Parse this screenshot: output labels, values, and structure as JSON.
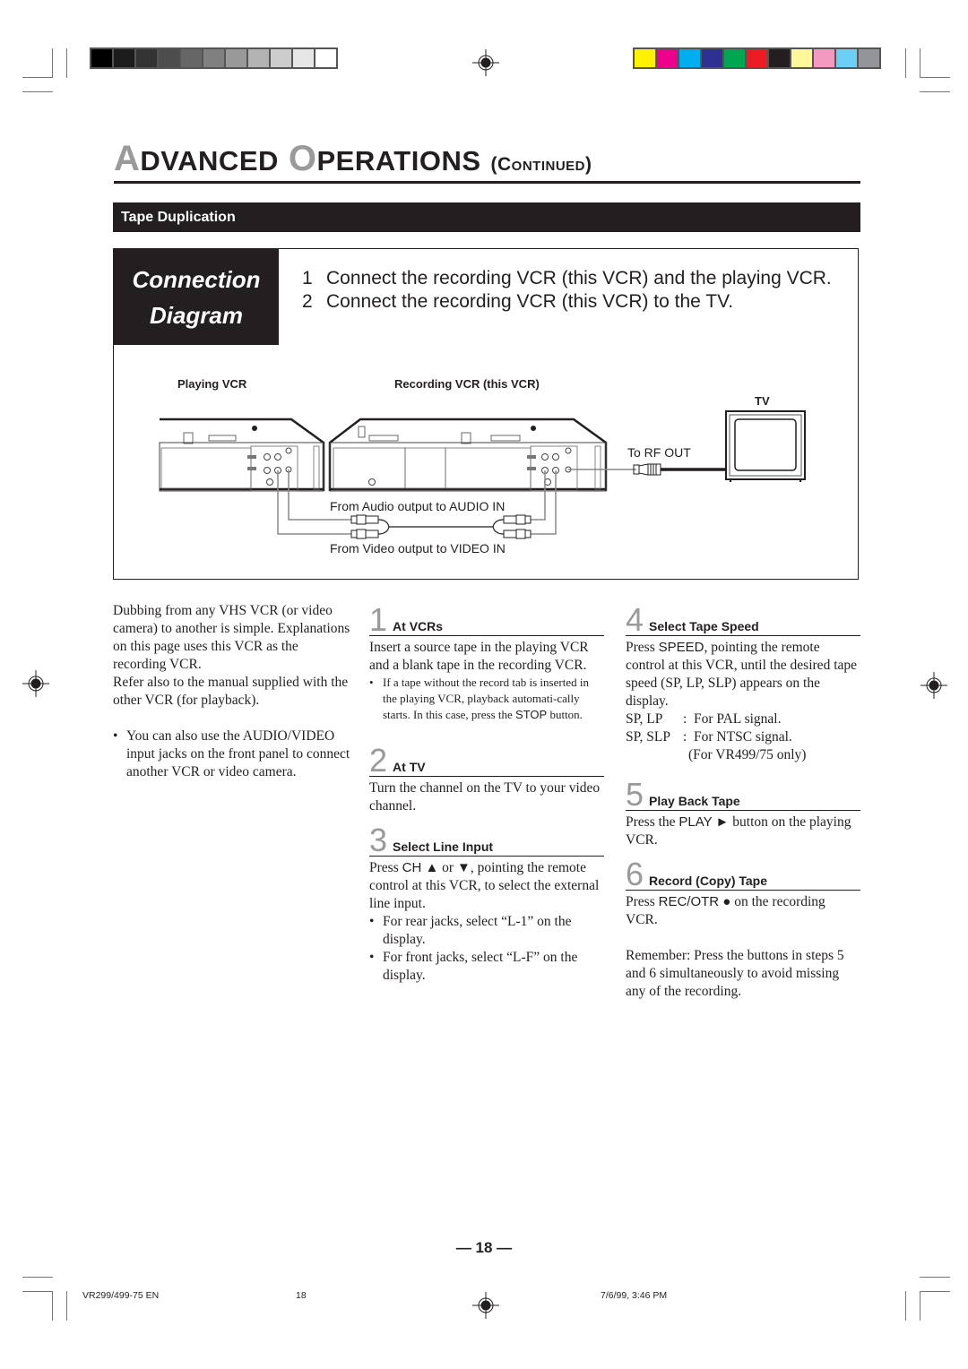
{
  "print_marks": {
    "grayscale_swatches": [
      "#000000",
      "#1c1c1c",
      "#333333",
      "#4d4d4d",
      "#666666",
      "#808080",
      "#999999",
      "#b3b3b3",
      "#cccccc",
      "#e6e6e6",
      "#ffffff"
    ],
    "color_swatches": [
      "#fff200",
      "#ec008c",
      "#00aeef",
      "#2e3192",
      "#00a651",
      "#ed1c24",
      "#231f20",
      "#fff799",
      "#f49ac1",
      "#6dcff6",
      "#939598"
    ]
  },
  "header": {
    "title_cap_a": "A",
    "title_rest_a": "DVANCED",
    "title_cap_o": "O",
    "title_rest_o": "PERATIONS",
    "title_paren_open": "(",
    "title_paren_cap": "C",
    "title_paren_rest": "ONTINUED",
    "title_paren_close": ")"
  },
  "section": {
    "title": "Tape Duplication"
  },
  "connection": {
    "label_line1": "Connection",
    "label_line2": "Diagram",
    "steps": [
      {
        "num": "1",
        "text": "Connect the recording VCR (this VCR) and the playing VCR."
      },
      {
        "num": "2",
        "text": "Connect the recording VCR (this VCR) to the TV."
      }
    ]
  },
  "diagram": {
    "playing_vcr_label": "Playing VCR",
    "recording_vcr_label": "Recording VCR (this VCR)",
    "tv_label": "TV",
    "rf_out_label": "To RF OUT",
    "audio_label": "From Audio output to AUDIO IN",
    "video_label": "From Video output to VIDEO IN"
  },
  "intro": {
    "paragraph": "Dubbing from any VHS VCR (or video camera) to another is simple. Explanations on this page uses this VCR as the recording VCR.",
    "paragraph2": "Refer also to the manual supplied with the other VCR (for playback).",
    "bullet": "You can also use the AUDIO/VIDEO input jacks on the front panel to connect another VCR or video camera."
  },
  "steps": [
    {
      "num": "1",
      "title": "At VCRs",
      "text": "Insert a source tape in the playing VCR and a blank tape in the recording VCR.",
      "bullet_pre": "If a tape without the record tab is inserted in the playing VCR, playback automati-cally starts. In this case, press the ",
      "bullet_key": "STOP",
      "bullet_post": " button."
    },
    {
      "num": "2",
      "title": "At TV",
      "text": "Turn the channel on the TV to your video channel."
    },
    {
      "num": "3",
      "title": "Select Line Input",
      "text_pre": "Press ",
      "key": "CH ▲",
      "text_mid": " or ",
      "key2": "▼",
      "text_post": ", pointing the remote control at this VCR, to select the external line input.",
      "bullets": [
        "For rear jacks, select “L-1” on the display.",
        "For front jacks, select “L-F” on the display."
      ]
    },
    {
      "num": "4",
      "title": "Select Tape Speed",
      "text_pre": "Press ",
      "key": "SPEED",
      "text_post": ", pointing the remote control at this VCR, until the desired tape speed (SP, LP, SLP) appears on the display.",
      "specs": [
        {
          "k": "SP, LP",
          "v": "For PAL signal."
        },
        {
          "k": "SP, SLP",
          "v": "For NTSC signal."
        }
      ],
      "spec_note": "(For VR499/75 only)"
    },
    {
      "num": "5",
      "title": "Play Back Tape",
      "text_pre": "Press the ",
      "key": "PLAY ►",
      "text_post": " button on the playing VCR."
    },
    {
      "num": "6",
      "title": "Record (Copy) Tape",
      "text_pre": "Press ",
      "key": "REC/OTR ●",
      "text_post": " on the recording VCR."
    }
  ],
  "remember": "Remember: Press the buttons in steps 5 and 6 simultaneously to avoid missing any of the recording.",
  "page_number": "— 18 —",
  "footer": {
    "doc_id": "VR299/499-75 EN",
    "page": "18",
    "timestamp": "7/6/99, 3:46 PM"
  }
}
